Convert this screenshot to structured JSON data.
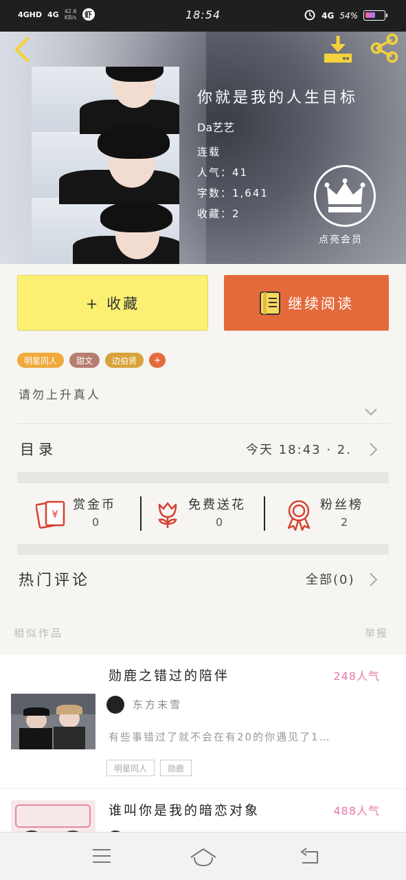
{
  "status_bar": {
    "left_signal1": "4GHD",
    "left_signal2": "4G",
    "net_speed": "42.6\nKB/s",
    "time": "18:54",
    "right_net": "4G",
    "battery": "54%",
    "battery_level": 0.54
  },
  "book": {
    "title": "你就是我的人生目标",
    "author": "Da艺艺",
    "status": "连载",
    "popularity": "人气：41",
    "words": "字数：1,641",
    "favorites": "收藏：2",
    "vip_label": "点亮会员"
  },
  "actions": {
    "collect": "+ 收藏",
    "continue": "继续阅读"
  },
  "tags": [
    {
      "label": "明星同人",
      "color": "#f0a93b"
    },
    {
      "label": "甜文",
      "color": "#b57e6f"
    },
    {
      "label": "边伯贤",
      "color": "#d8a33a"
    },
    {
      "label": "+",
      "color": "#e46a3b"
    }
  ],
  "description": "请勿上升真人",
  "toc": {
    "label": "目录",
    "update": "今天 18:43 · 2."
  },
  "stats": [
    {
      "label": "赏金币",
      "value": "0",
      "icon": "red-envelope-icon"
    },
    {
      "label": "免费送花",
      "value": "0",
      "icon": "flower-icon"
    },
    {
      "label": "粉丝榜",
      "value": "2",
      "icon": "medal-icon"
    }
  ],
  "comments": {
    "label": "热门评论",
    "all": "全部(0)"
  },
  "similar": {
    "heading": "相似作品",
    "report": "举报",
    "items": [
      {
        "title": "勋鹿之错过的陪伴",
        "popularity": "248人气",
        "author": "东方末雪",
        "summary": "有些事错过了就不会在有20的你遇见了1…",
        "tags": [
          "明星同人",
          "勋鹿"
        ]
      },
      {
        "title": "谁叫你是我的暗恋对象",
        "popularity": "488人气"
      }
    ]
  },
  "colors": {
    "collect_bg": "#fbf071",
    "read_bg": "#e46a3b",
    "popularity": "#e879a6",
    "icon_red": "#d8402f"
  }
}
